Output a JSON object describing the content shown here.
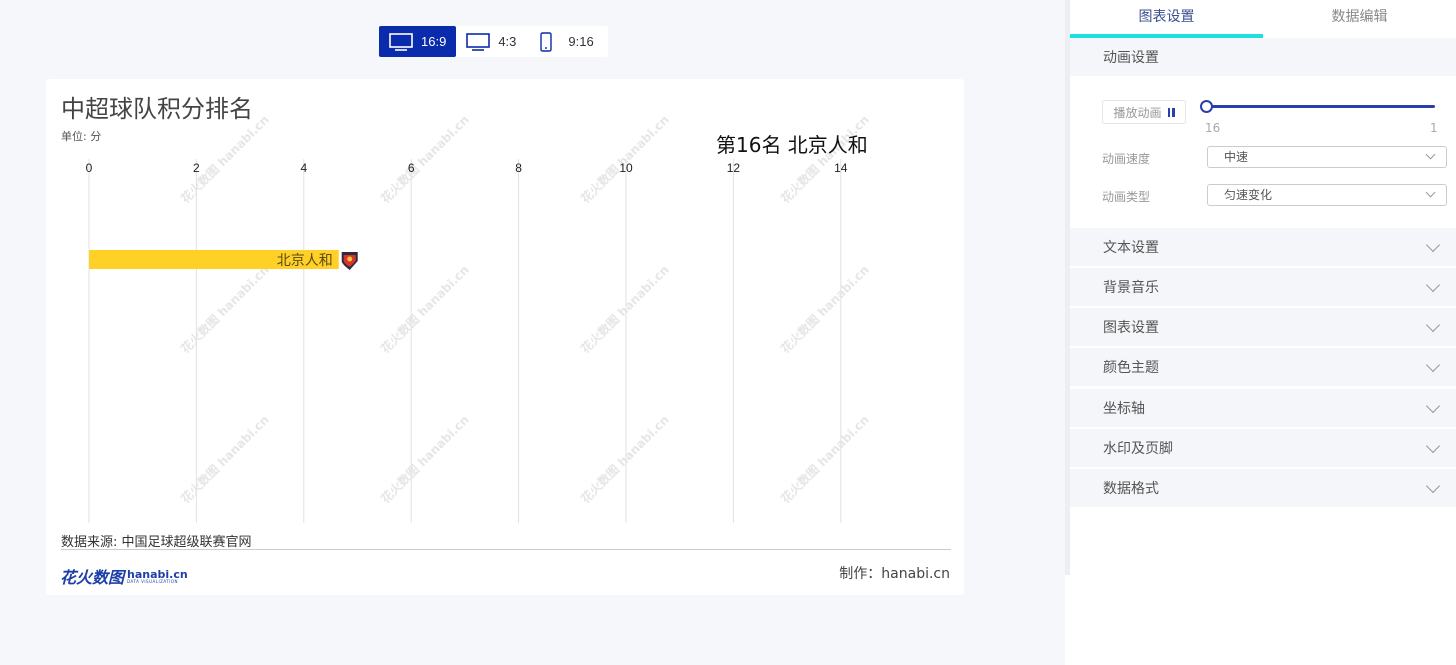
{
  "aspect_options": [
    {
      "label": "16:9",
      "active": true,
      "icon": "monitor-wide-icon"
    },
    {
      "label": "4:3",
      "active": false,
      "icon": "monitor-icon"
    },
    {
      "label": "9:16",
      "active": false,
      "icon": "phone-icon"
    }
  ],
  "chart": {
    "title": "中超球队积分排名",
    "unit": "单位: 分",
    "rank_label": "第16名 北京人和",
    "source": "数据来源: 中国足球超级联赛官网",
    "maker": "制作：hanabi.cn",
    "logo_cn": "花火数图",
    "logo_en": "hanabi.cn",
    "logo_en_sub": "DATA VISUALIZATION",
    "watermark": "花火数图 hanabi.cn"
  },
  "chart_data": {
    "type": "bar",
    "orientation": "horizontal",
    "categories": [
      "北京人和"
    ],
    "values": [
      4.65
    ],
    "xlim": [
      0,
      14
    ],
    "x_ticks": [
      0,
      2,
      4,
      6,
      8,
      10,
      12,
      14
    ],
    "bar_color": "#ffd026",
    "team_icon": "team-crest-icon"
  },
  "panel": {
    "tabs": [
      "图表设置",
      "数据编辑"
    ],
    "active_tab": 0,
    "animation_section": "动画设置",
    "play_button": "播放动画",
    "slider_min": "16",
    "slider_max": "1",
    "speed_label": "动画速度",
    "speed_value": "中速",
    "type_label": "动画类型",
    "type_value": "匀速变化",
    "sections": [
      "文本设置",
      "背景音乐",
      "图表设置",
      "颜色主题",
      "坐标轴",
      "水印及页脚",
      "数据格式"
    ]
  },
  "colors": {
    "accent": "#0a2bab",
    "tab_underline": "#1fe0e0",
    "slider": "#2a3fae"
  }
}
